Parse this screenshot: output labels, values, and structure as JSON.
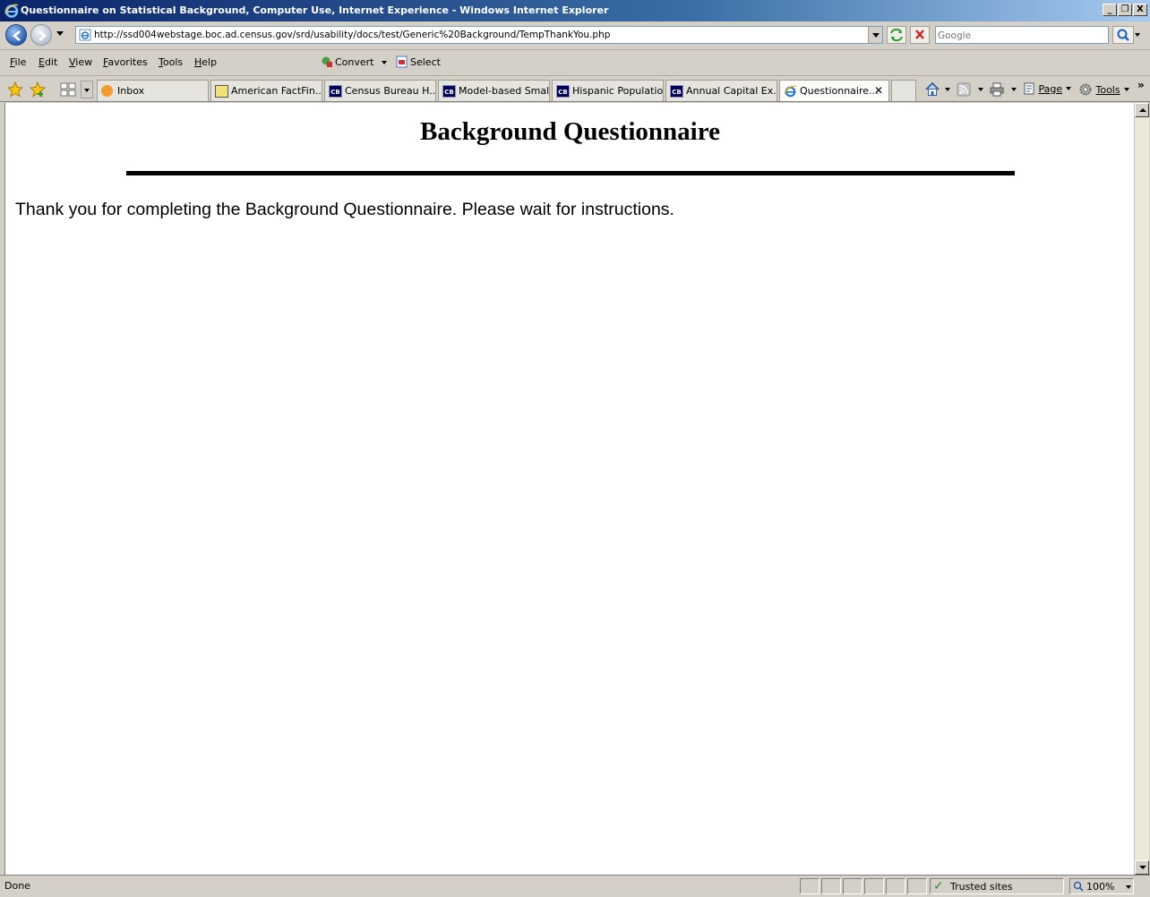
{
  "window": {
    "title": "Questionnaire on Statistical Background, Computer Use, Internet Experience - Windows Internet Explorer",
    "controls": {
      "minimize": "_",
      "restore": "❐",
      "close": "X"
    }
  },
  "address_bar": {
    "url": "http://ssd004webstage.boc.ad.census.gov/srd/usability/docs/test/Generic%20Background/TempThankYou.php"
  },
  "search": {
    "placeholder": "Google"
  },
  "menu": {
    "items": [
      {
        "label": "File",
        "underline": "F",
        "rest": "ile"
      },
      {
        "label": "Edit",
        "underline": "E",
        "rest": "dit"
      },
      {
        "label": "View",
        "underline": "V",
        "rest": "iew"
      },
      {
        "label": "Favorites",
        "underline": "F",
        "rest": "avorites"
      },
      {
        "label": "Tools",
        "underline": "T",
        "rest": "ools"
      },
      {
        "label": "Help",
        "underline": "H",
        "rest": "elp"
      }
    ],
    "convert_label": "Convert",
    "select_label": "Select"
  },
  "tabs": [
    {
      "label": "Inbox",
      "icon": "outlook-icon",
      "active": false
    },
    {
      "label": "American FactFin...",
      "icon": "factfinder-icon",
      "active": false
    },
    {
      "label": "Census Bureau H...",
      "icon": "cb-icon",
      "active": false
    },
    {
      "label": "Model-based Smal...",
      "icon": "cb-icon",
      "active": false
    },
    {
      "label": "Hispanic Populatio...",
      "icon": "cb-icon",
      "active": false
    },
    {
      "label": "Annual Capital Ex...",
      "icon": "cb-icon",
      "active": false
    },
    {
      "label": "Questionnaire...",
      "icon": "ie-icon",
      "active": true
    }
  ],
  "tab_icon_text": "CB",
  "command_bar": {
    "page_label": "Page",
    "tools_label": "Tools"
  },
  "page": {
    "heading": "Background Questionnaire",
    "message": "Thank you for completing the Background Questionnaire. Please wait for instructions."
  },
  "status_bar": {
    "status": "Done",
    "zone": "Trusted sites",
    "zoom": "100%"
  }
}
